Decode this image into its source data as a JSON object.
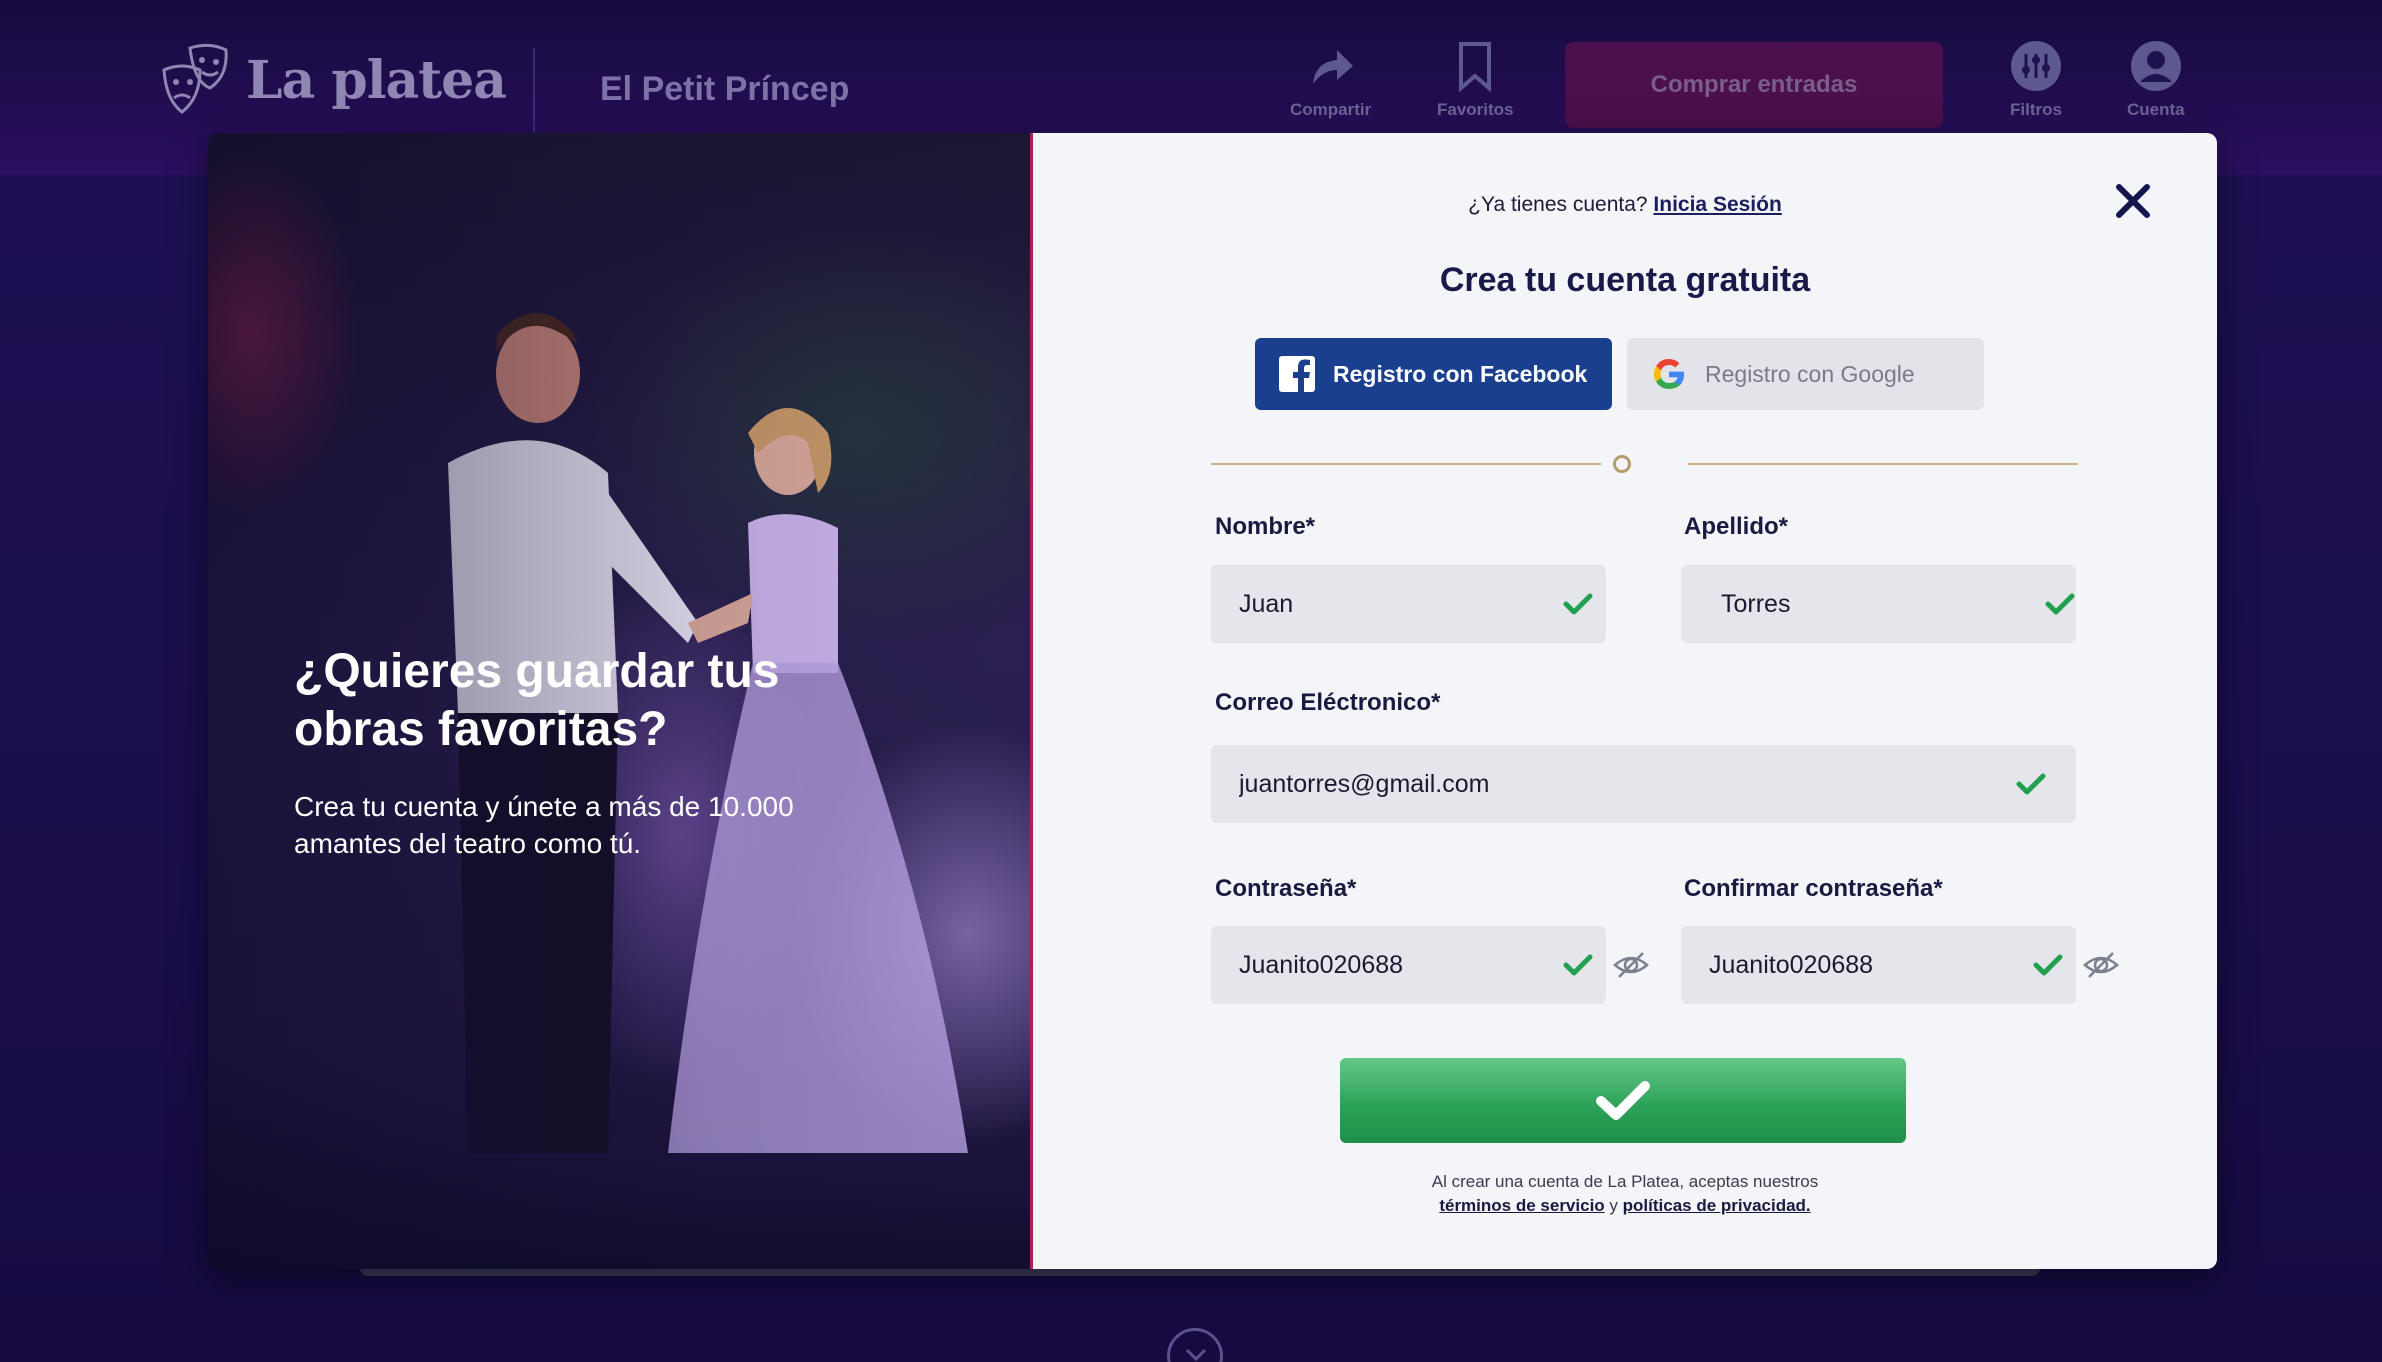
{
  "header": {
    "logo_text": "La platea",
    "show_title": "El Petit Príncep",
    "share_label": "Compartir",
    "favorites_label": "Favoritos",
    "buy_label": "Comprar entradas",
    "filters_label": "Filtros",
    "account_label": "Cuenta"
  },
  "promo": {
    "title": "¿Quieres guardar tus obras favoritas?",
    "subtitle": "Crea tu cuenta y únete a más de 10.000 amantes del teatro como tú."
  },
  "form": {
    "login_prompt": "¿Ya tienes cuenta?",
    "login_link": "Inicia Sesión",
    "title": "Crea tu cuenta gratuita",
    "facebook_label": "Registro con Facebook",
    "google_label": "Registro con Google",
    "first_name_label": "Nombre*",
    "first_name_value": "Juan",
    "last_name_label": "Apellido*",
    "last_name_value": "Torres",
    "email_label": "Correo Eléctronico*",
    "email_value": "juantorres@gmail.com",
    "password_label": "Contraseña*",
    "password_value": "Juanito020688",
    "confirm_label": "Confirmar contraseña*",
    "confirm_value": "Juanito020688",
    "legal_text": "Al crear una cuenta de La Platea, aceptas nuestros",
    "terms_link": "términos de servicio",
    "legal_and": "y",
    "privacy_link": "políticas de privacidad."
  },
  "colors": {
    "facebook_blue": "#1b3f8f",
    "submit_green": "#2da35a",
    "check_green": "#22a050",
    "buy_button": "#4a0f4c",
    "background": "#1a0d47"
  }
}
